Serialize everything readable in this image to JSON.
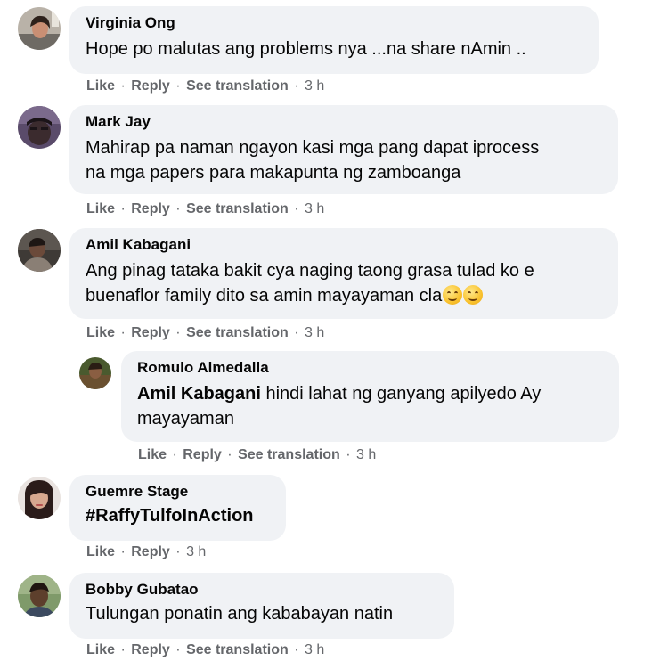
{
  "actions": {
    "like": "Like",
    "reply": "Reply",
    "see_translation": "See translation",
    "separator": "·"
  },
  "comments": [
    {
      "author": "Virginia Ong",
      "text": "Hope po malutas ang problems nya ...na share nAmin ..",
      "time": "3 h"
    },
    {
      "author": "Mark Jay",
      "text": "Mahirap pa naman ngayon kasi mga pang dapat iprocess\nna mga papers para makapunta ng zamboanga",
      "time": "3 h"
    },
    {
      "author": "Amil Kabagani",
      "text_line1": "Ang pinag tataka bakit cya naging taong grasa tulad ko e",
      "text_line2": "buenaflor family dito sa amin mayayaman cla",
      "emoji": "smiling-face",
      "time": "3 h",
      "reply": {
        "author": "Romulo Almedalla",
        "mention": "Amil Kabagani",
        "text": " hindi lahat ng ganyang apilyedo Ay\nmayayaman",
        "time": "3 h"
      }
    },
    {
      "author": "Guemre Stage",
      "text": "#RaffyTulfoInAction",
      "time": "3 h"
    },
    {
      "author": "Bobby Gubatao",
      "text": "Tulungan ponatin ang kababayan natin",
      "time": "3 h"
    }
  ]
}
